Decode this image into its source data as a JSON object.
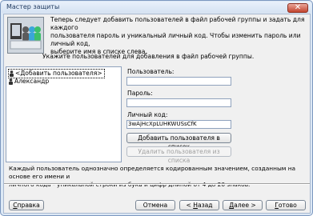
{
  "window": {
    "title": "Мастер защиты",
    "close_glyph": "✕"
  },
  "intro": {
    "line1": "Теперь следует добавить пользователей в файл рабочей группы и задать для каждого",
    "line2": "пользователя пароль и уникальный личный код. Чтобы изменить пароль или личный код,",
    "line3": "выберите имя в списке слева.",
    "instruction": "Укажите пользователей для добавления в файл рабочей группы."
  },
  "users": {
    "items": [
      {
        "label": "<Добавить пользователя>",
        "icon": "user-icon",
        "selected": true
      },
      {
        "label": "Александр",
        "icon": "user-icon",
        "selected": false
      }
    ]
  },
  "form": {
    "user_label": "Пользователь:",
    "user_value": "",
    "password_label": "Пароль:",
    "password_value": "",
    "pid_label": "Личный код:",
    "pid_value": "3wAjHcXpLUHKWUSsCfK",
    "add_button": "Добавить пользователя в список",
    "remove_button": "Удалить пользователя из списка"
  },
  "footnote": {
    "line1": "Каждый пользователь однозначно определяется кодированным значением, созданным на основе его имени и",
    "line2": "личного кода - уникальной строки из букв и цифр длиной от 4 до 20 знаков."
  },
  "buttons": {
    "help_u": "С",
    "help_rest": "правка",
    "cancel": "Отмена",
    "back_prefix": "< ",
    "back_u": "Н",
    "back_rest": "азад",
    "next_u": "Д",
    "next_rest": "алее >",
    "finish_u": "Г",
    "finish_rest": "отово"
  }
}
